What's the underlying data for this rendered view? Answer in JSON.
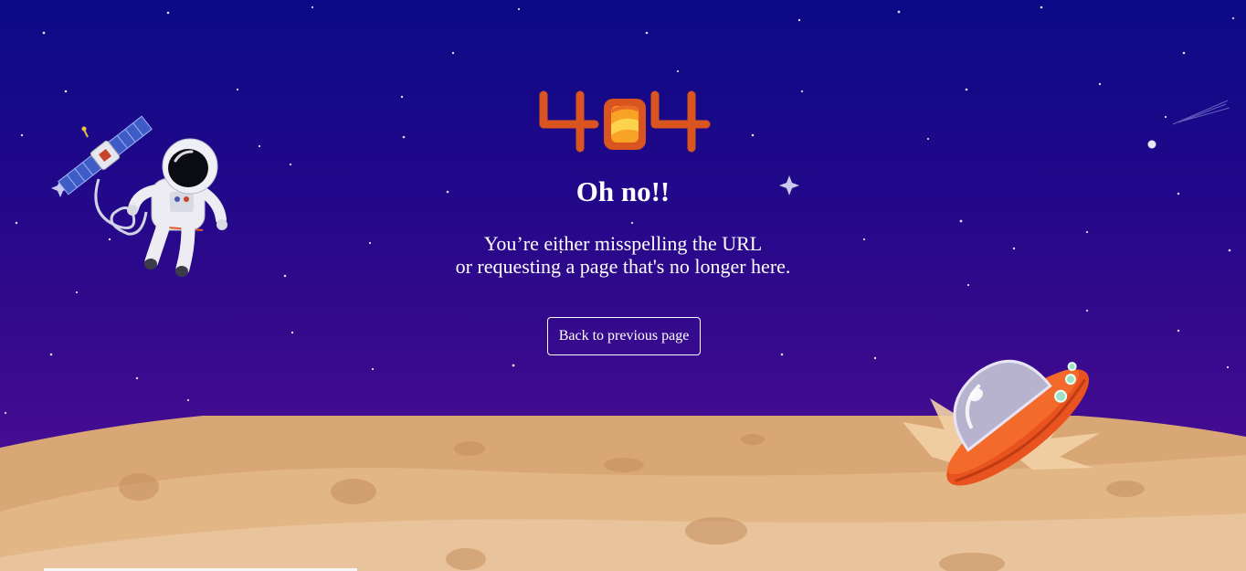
{
  "page": {
    "error_code": "404",
    "headline": "Oh no!!",
    "message_line1": "You’re either misspelling the URL",
    "message_line2": "or requesting a page that's no longer here.",
    "back_button_label": "Back to previous page"
  },
  "illustrations": {
    "astronaut": "astronaut-icon",
    "satellite": "satellite-icon",
    "spaceship": "crashed-spaceship-icon",
    "moon": "moon-surface",
    "shooting_star": "shooting-star-icon"
  },
  "colors": {
    "sky_top": "#0b0a86",
    "sky_bottom": "#54129a",
    "moon_surface": "#e2b47f",
    "code_orange": "#d9541e",
    "text": "#ffffff"
  }
}
